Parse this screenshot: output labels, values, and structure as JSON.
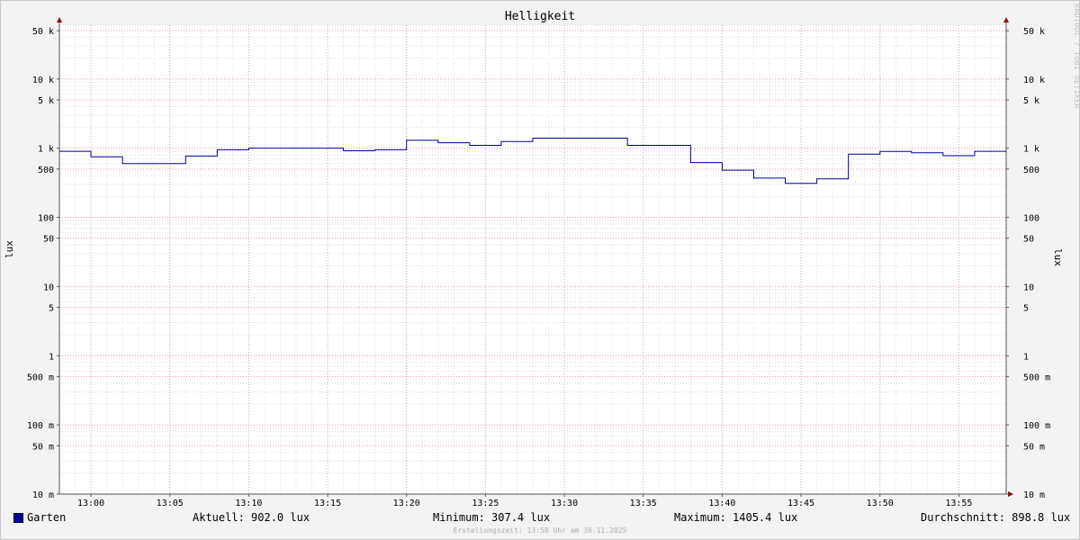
{
  "chart_data": {
    "type": "line",
    "title": "Helligkeit",
    "ylabel": "lux",
    "yscale": "log",
    "ylim": [
      0.01,
      60000
    ],
    "y_ticks": [
      {
        "v": 0.01,
        "label": "10 m"
      },
      {
        "v": 0.05,
        "label": "50 m"
      },
      {
        "v": 0.1,
        "label": "100 m"
      },
      {
        "v": 0.5,
        "label": "500 m"
      },
      {
        "v": 1,
        "label": "1"
      },
      {
        "v": 5,
        "label": "5"
      },
      {
        "v": 10,
        "label": "10"
      },
      {
        "v": 50,
        "label": "50"
      },
      {
        "v": 100,
        "label": "100"
      },
      {
        "v": 500,
        "label": "500"
      },
      {
        "v": 1000,
        "label": "1 k"
      },
      {
        "v": 5000,
        "label": "5 k"
      },
      {
        "v": 10000,
        "label": "10 k"
      },
      {
        "v": 50000,
        "label": "50 k"
      }
    ],
    "x_ticks": [
      "13:00",
      "13:05",
      "13:10",
      "13:15",
      "13:20",
      "13:25",
      "13:30",
      "13:35",
      "13:40",
      "13:45",
      "13:50",
      "13:55"
    ],
    "x_range": [
      "12:58",
      "13:58"
    ],
    "grid": true,
    "series": [
      {
        "name": "Garten",
        "color": "#000099",
        "step": true,
        "x": [
          "12:58",
          "13:00",
          "13:02",
          "13:04",
          "13:06",
          "13:08",
          "13:10",
          "13:12",
          "13:14",
          "13:16",
          "13:18",
          "13:20",
          "13:22",
          "13:24",
          "13:26",
          "13:28",
          "13:30",
          "13:32",
          "13:34",
          "13:36",
          "13:38",
          "13:40",
          "13:42",
          "13:44",
          "13:46",
          "13:48",
          "13:50",
          "13:52",
          "13:54",
          "13:56"
        ],
        "y": [
          902,
          750,
          600,
          600,
          770,
          950,
          1000,
          1000,
          1000,
          920,
          950,
          1300,
          1200,
          1100,
          1250,
          1400,
          1400,
          1400,
          1100,
          1100,
          620,
          480,
          370,
          310,
          360,
          820,
          900,
          860,
          780,
          902
        ]
      }
    ]
  },
  "legend": {
    "name": "Garten",
    "current": "Aktuell: 902.0 lux",
    "minimum": "Minimum: 307.4 lux",
    "maximum": "Maximum: 1405.4 lux",
    "average": "Durchschnitt: 898.8 lux"
  },
  "watermark": "RRDTOOL / TOBI OETIKER",
  "footer": "Erstellungszeit: 13:58 Uhr am 30.11.2025"
}
